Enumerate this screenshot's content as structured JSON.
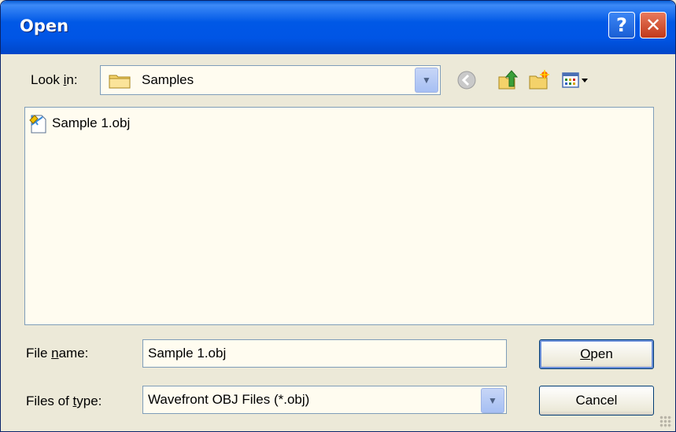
{
  "window": {
    "title": "Open",
    "help_label": "?",
    "close_label": "✕"
  },
  "look_in": {
    "label_pre": "Look ",
    "label_accel": "i",
    "label_post": "n:",
    "value": "Samples",
    "icon": "folder-icon"
  },
  "toolbar": {
    "icons": [
      "back-icon",
      "up-folder-icon",
      "new-folder-icon",
      "view-menu-icon"
    ]
  },
  "files": [
    {
      "name": "Sample 1.obj",
      "icon": "obj-file-icon"
    }
  ],
  "file_name": {
    "label_pre": "File ",
    "label_accel": "n",
    "label_post": "ame:",
    "value": "Sample 1.obj"
  },
  "file_type": {
    "label_pre": "Files of ",
    "label_accel": "t",
    "label_post": "ype:",
    "value": "Wavefront OBJ Files (*.obj)"
  },
  "buttons": {
    "open_accel": "O",
    "open_rest": "pen",
    "cancel": "Cancel"
  },
  "colors": {
    "titlebar": "#0055e5",
    "close": "#c1391b",
    "face": "#ece9d8",
    "field": "#fffcf0"
  }
}
